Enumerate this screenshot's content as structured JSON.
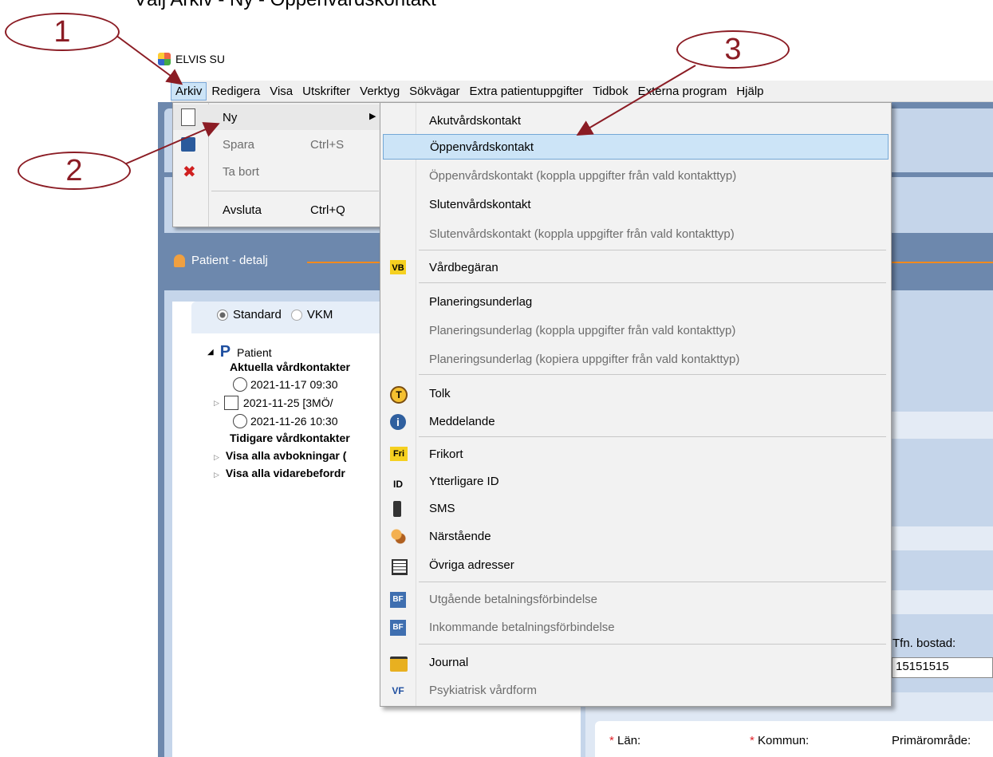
{
  "caption": "Välj Arkiv - Ny - Öppenvårdskontakt",
  "callouts": [
    "1",
    "2",
    "3"
  ],
  "app_title": "ELVIS SU",
  "menubar": [
    "Arkiv",
    "Redigera",
    "Visa",
    "Utskrifter",
    "Verktyg",
    "Sökvägar",
    "Extra patientuppgifter",
    "Tidbok",
    "Externa program",
    "Hjälp"
  ],
  "arkiv_menu": {
    "items": [
      {
        "label": "Ny",
        "shortcut": "",
        "icon": "new-document-icon",
        "enabled": true,
        "submenu": true
      },
      {
        "label": "Spara",
        "shortcut": "Ctrl+S",
        "icon": "save-disk-icon",
        "enabled": false
      },
      {
        "label": "Ta bort",
        "shortcut": "",
        "icon": "delete-x-icon",
        "enabled": false
      },
      {
        "label": "Avsluta",
        "shortcut": "Ctrl+Q",
        "icon": "",
        "enabled": true
      }
    ]
  },
  "ny_menu": {
    "items": [
      {
        "label": "Akutvårdskontakt",
        "enabled": true
      },
      {
        "label": "Öppenvårdskontakt",
        "enabled": true,
        "selected": true
      },
      {
        "label": "Öppenvårdskontakt (koppla uppgifter från vald kontakttyp)",
        "enabled": false
      },
      {
        "label": "Slutenvårdskontakt",
        "enabled": true
      },
      {
        "label": "Slutenvårdskontakt (koppla uppgifter från vald kontakttyp)",
        "enabled": false
      },
      {
        "label": "Vårdbegäran",
        "enabled": true,
        "icon": "vb-icon",
        "icon_text": "VB"
      },
      {
        "label": "Planeringsunderlag",
        "enabled": true
      },
      {
        "label": "Planeringsunderlag (koppla uppgifter från vald kontakttyp)",
        "enabled": false
      },
      {
        "label": "Planeringsunderlag (kopiera uppgifter från vald kontakttyp)",
        "enabled": false
      },
      {
        "label": "Tolk",
        "enabled": true,
        "icon": "interpreter-icon",
        "icon_text": "T"
      },
      {
        "label": "Meddelande",
        "enabled": true,
        "icon": "info-icon",
        "icon_text": "i"
      },
      {
        "label": "Frikort",
        "enabled": true,
        "icon": "frikort-icon",
        "icon_text": "Fri"
      },
      {
        "label": "Ytterligare ID",
        "enabled": true,
        "icon": "id-icon",
        "icon_text": "ID"
      },
      {
        "label": "SMS",
        "enabled": true,
        "icon": "mobile-phone-icon"
      },
      {
        "label": "Närstående",
        "enabled": true,
        "icon": "relatives-icon"
      },
      {
        "label": "Övriga adresser",
        "enabled": true,
        "icon": "address-icon"
      },
      {
        "label": "Utgående betalningsförbindelse",
        "enabled": false,
        "icon": "outgoing-payment-icon",
        "icon_text": "BF"
      },
      {
        "label": "Inkommande betalningsförbindelse",
        "enabled": false,
        "icon": "incoming-payment-icon",
        "icon_text": "BF"
      },
      {
        "label": "Journal",
        "enabled": true,
        "icon": "folder-icon"
      },
      {
        "label": "Psykiatrisk vårdform",
        "enabled": false,
        "icon": "vf-icon",
        "icon_text": "VF"
      }
    ]
  },
  "patient_panel": {
    "title": "Patient - detalj",
    "radio_standard": "Standard",
    "radio_vkm": "VKM",
    "tree_root": "Patient",
    "tree_root_icon_text": "P",
    "current_contacts": "Aktuella vårdkontakter",
    "contacts": [
      "2021-11-17 09:30",
      "2021-11-25   [3MÖ/",
      "2021-11-26 10:30"
    ],
    "previous_contacts": "Tidigare vårdkontakter",
    "cancellations": "Visa alla avbokningar (",
    "referrals": "Visa alla vidarebefordr"
  },
  "form": {
    "phone_label": "Tfn. bostad:",
    "phone_value": "15151515",
    "lan_label": "Län:",
    "kommun_label": "Kommun:",
    "primary_area_label": "Primärområde:"
  }
}
